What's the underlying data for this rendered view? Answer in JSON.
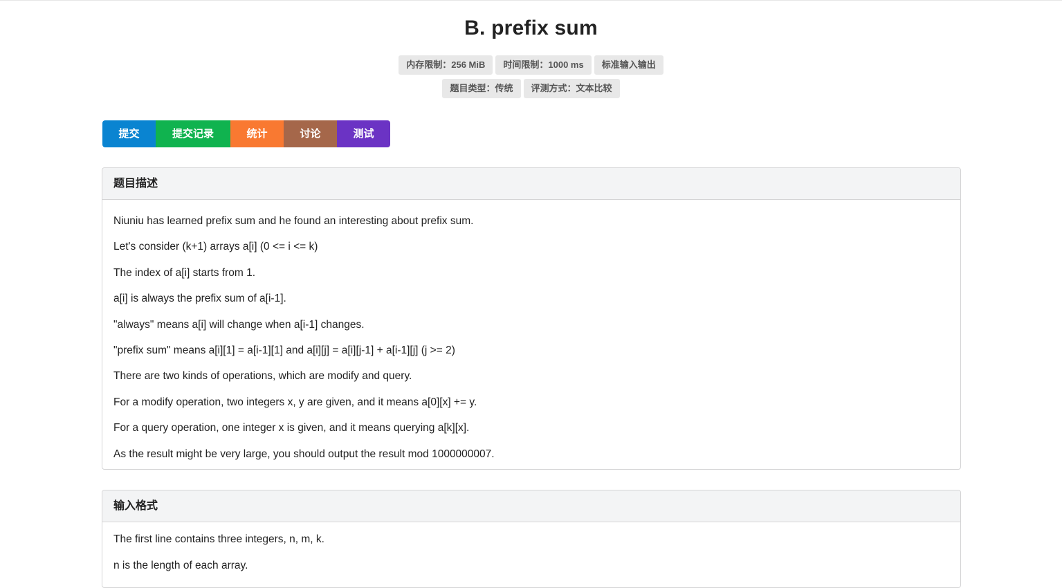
{
  "problem": {
    "title": "B. prefix sum",
    "meta_row1": [
      "内存限制：256 MiB",
      "时间限制：1000 ms",
      "标准输入输出"
    ],
    "meta_row2": [
      "题目类型：传统",
      "评测方式：文本比较"
    ]
  },
  "actions": {
    "submit": "提交",
    "records": "提交记录",
    "stats": "统计",
    "discuss": "讨论",
    "test": "测试",
    "colors": {
      "submit": "#0a84d1",
      "records": "#10b34f",
      "stats": "#f97931",
      "discuss": "#a5674a",
      "test": "#6b33c4"
    }
  },
  "description": {
    "heading": "题目描述",
    "lines": [
      "Niuniu has learned prefix sum and he found an interesting about prefix sum.",
      "Let's consider (k+1) arrays a[i] (0 <= i <= k)",
      "The index of a[i] starts from 1.",
      "a[i] is always the prefix sum of a[i-1].",
      "\"always\" means a[i] will change when a[i-1] changes.",
      "\"prefix sum\" means a[i][1] = a[i-1][1] and a[i][j] = a[i][j-1] + a[i-1][j] (j >= 2)",
      "There are two kinds of operations, which are modify and query.",
      "For a modify operation, two integers x, y are given, and it means a[0][x] += y.",
      "For a query operation, one integer x is given, and it means querying a[k][x].",
      "As the result might be very large, you should output the result mod 1000000007."
    ]
  },
  "input_format": {
    "heading": "输入格式",
    "lines": [
      "The first line contains three integers, n, m, k.",
      "n is the length of each array."
    ]
  }
}
